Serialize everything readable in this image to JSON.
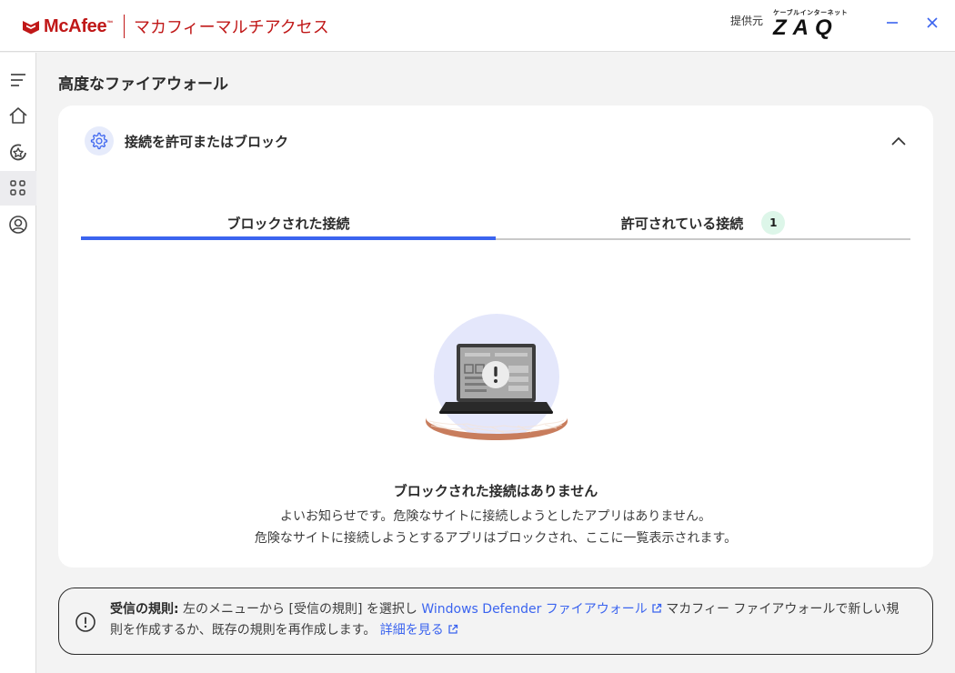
{
  "app": {
    "brand_name": "McAfee",
    "brand_tm": "™",
    "product_name": "マカフィーマルチアクセス",
    "provider_label": "提供元",
    "provider_sub": "ケーブルインターネット",
    "provider_name": "ZAQ",
    "accent_color": "#3b64ef",
    "brand_color": "#c01818"
  },
  "window": {
    "minimize_icon": "minimize-icon",
    "close_icon": "close-icon"
  },
  "sidebar": {
    "items": [
      {
        "name": "menu",
        "icon": "menu-icon"
      },
      {
        "name": "home",
        "icon": "home-icon"
      },
      {
        "name": "protection",
        "icon": "protection-icon"
      },
      {
        "name": "apps",
        "icon": "apps-grid-icon",
        "active": true
      },
      {
        "name": "account",
        "icon": "account-icon"
      }
    ]
  },
  "page": {
    "title": "高度なファイアウォール"
  },
  "card": {
    "title": "接続を許可またはブロック",
    "icon": "gear-icon",
    "collapse_icon": "chevron-up-icon",
    "tabs": [
      {
        "label": "ブロックされた接続",
        "active": true
      },
      {
        "label": "許可されている接続",
        "badge": "1",
        "active": false
      }
    ],
    "empty_state": {
      "illustration": "laptop-warning-illustration",
      "title": "ブロックされた接続はありません",
      "line1": "よいお知らせです。危険なサイトに接続しようとしたアプリはありません。",
      "line2": "危険なサイトに接続しようとするアプリはブロックされ、ここに一覧表示されます。"
    }
  },
  "info": {
    "icon": "info-icon",
    "bold_label": "受信の規則:",
    "text_before_link": " 左のメニューから [受信の規則] を選択し ",
    "link1": "Windows Defender ファイアウォール",
    "text_after_link": " マカフィー ファイアウォールで新しい規則を作成するか、既存の規則を再作成します。 ",
    "link2": "詳細を見る"
  }
}
